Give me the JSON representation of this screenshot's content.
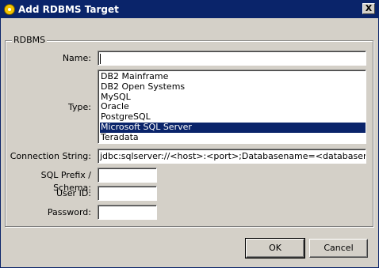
{
  "window": {
    "title": "Add RDBMS Target",
    "close_glyph": "X"
  },
  "group": {
    "label": "RDBMS"
  },
  "form": {
    "name_label": "Name:",
    "name_value": "",
    "type_label": "Type:",
    "type_options": [
      "DB2 Mainframe",
      "DB2 Open Systems",
      "MySQL",
      "Oracle",
      "PostgreSQL",
      "Microsoft SQL Server",
      "Teradata"
    ],
    "type_selected": "Microsoft SQL Server",
    "connection_label": "Connection String:",
    "connection_value": "jdbc:sqlserver://<host>:<port>;Databasename=<databasename>",
    "sql_prefix_label": "SQL Prefix / Schema:",
    "sql_prefix_value": "",
    "user_id_label": "User ID:",
    "user_id_value": "",
    "password_label": "Password:",
    "password_value": ""
  },
  "buttons": {
    "ok_label": "OK",
    "cancel_label": "Cancel"
  }
}
